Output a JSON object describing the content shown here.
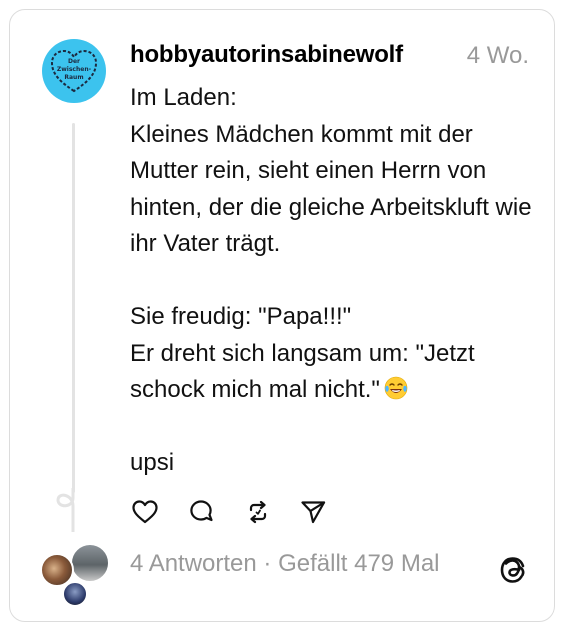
{
  "post": {
    "username": "hobbyautorinsabinewolf",
    "time": "4 Wo.",
    "text_main": "Im Laden:\nKleines Mädchen kommt mit der Mutter rein, sieht einen Herrn von hinten, der die gleiche Arbeitskluft wie ihr Vater trägt.\n\nSie freudig: \"Papa!!!\"\nEr dreht sich langsam um: \"Jetzt schock mich mal nicht.\"",
    "text_end": "\n\nupsi",
    "emoji": "tears-of-joy-emoji"
  },
  "avatar": {
    "logo_text": [
      "Der",
      "Zwischen-",
      "Raum"
    ],
    "color": "#3cc3ee"
  },
  "actions": [
    {
      "name": "like",
      "icon": "heart-icon"
    },
    {
      "name": "comment",
      "icon": "comment-icon"
    },
    {
      "name": "repost",
      "icon": "repost-icon"
    },
    {
      "name": "share",
      "icon": "send-icon"
    }
  ],
  "footer": {
    "replies": "4 Antworten",
    "separator": " · ",
    "likes": "Gefällt 479 Mal"
  },
  "brand": {
    "icon": "threads-logo-icon"
  },
  "colors": {
    "muted": "#999999",
    "avatar_bg": "#3cc3ee",
    "border": "#dcdcdc"
  }
}
